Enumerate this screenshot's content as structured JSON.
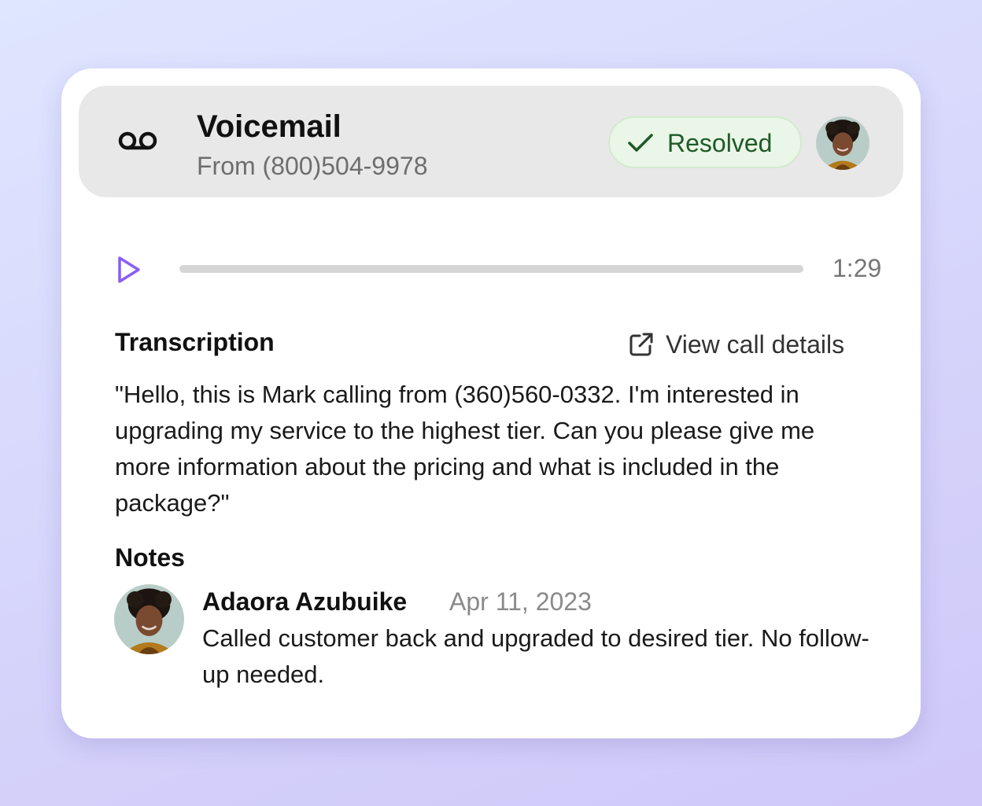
{
  "voicemail": {
    "title": "Voicemail",
    "subtitle": "From (800)504-9978",
    "icon": "voicemail-icon",
    "status": {
      "label": "Resolved",
      "icon": "check-icon",
      "color": "#1f5a28",
      "background": "#eaf6e8"
    },
    "assignee_avatar": "avatar"
  },
  "player": {
    "play_icon": "play-icon",
    "progress": 0,
    "duration": "1:29",
    "accent": "#8b5cf6"
  },
  "transcription": {
    "heading": "Transcription",
    "link_label": "View call details",
    "link_icon": "external-link-icon",
    "text": "\"Hello, this is Mark calling from (360)560-0332. I'm interested in upgrading my service to the highest tier. Can you please give me more information about the pricing and what is included in the package?\""
  },
  "notes": {
    "heading": "Notes",
    "items": [
      {
        "author": "Adaora Azubuike",
        "date": "Apr 11, 2023",
        "text": "Called customer back and upgraded to desired tier. No follow-up needed."
      }
    ]
  }
}
